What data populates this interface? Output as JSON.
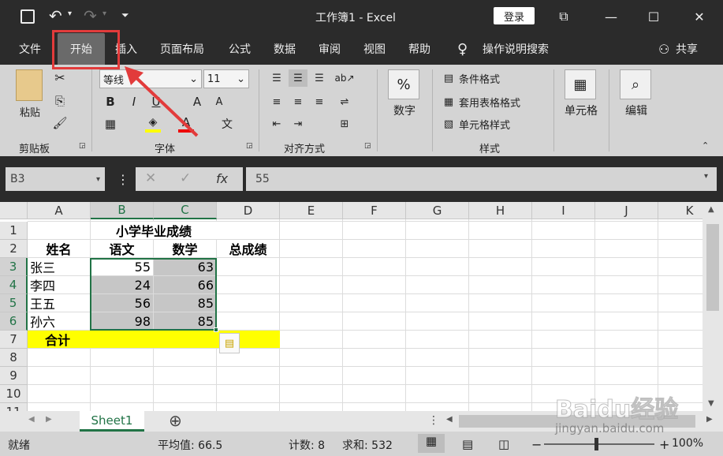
{
  "titlebar": {
    "title": "工作簿1 - Excel",
    "login": "登录",
    "undo": "↶",
    "redo": "↷"
  },
  "tabs": [
    "文件",
    "开始",
    "插入",
    "页面布局",
    "公式",
    "数据",
    "审阅",
    "视图",
    "帮助"
  ],
  "tell_me": "操作说明搜索",
  "share": "共享",
  "ribbon": {
    "clipboard": {
      "paste": "粘贴",
      "label": "剪贴板"
    },
    "font": {
      "name": "等线",
      "size": "11",
      "bold": "B",
      "italic": "I",
      "underline": "U",
      "grow": "A",
      "shrink": "A",
      "color": "A",
      "phonetic": "文",
      "label": "字体"
    },
    "alignment": {
      "label": "对齐方式"
    },
    "number": {
      "symbol": "%",
      "label": "数字"
    },
    "styles": {
      "conditional": "条件格式",
      "table": "套用表格格式",
      "cell": "单元格样式",
      "label": "样式"
    },
    "cells": {
      "label": "单元格"
    },
    "editing": {
      "label": "编辑"
    }
  },
  "formula_bar": {
    "name_box": "B3",
    "fx": "fx",
    "value": "55"
  },
  "columns": [
    "A",
    "B",
    "C",
    "D",
    "E",
    "F",
    "G",
    "H",
    "I",
    "J",
    "K"
  ],
  "rows": [
    "1",
    "2",
    "3",
    "4",
    "5",
    "6",
    "7",
    "8",
    "9",
    "10",
    "11"
  ],
  "sheet": {
    "title": "小学毕业成绩",
    "headers": {
      "name": "姓名",
      "chinese": "语文",
      "math": "数学",
      "total": "总成绩"
    },
    "records": [
      {
        "name": "张三",
        "chinese": "55",
        "math": "63"
      },
      {
        "name": "李四",
        "chinese": "24",
        "math": "66"
      },
      {
        "name": "王五",
        "chinese": "56",
        "math": "85"
      },
      {
        "name": "孙六",
        "chinese": "98",
        "math": "85"
      }
    ],
    "sum_label": "合计"
  },
  "sheet_tab": "Sheet1",
  "add_sheet": "⊕",
  "status": {
    "ready": "就绪",
    "average": "平均值: 66.5",
    "count": "计数: 8",
    "sum": "求和: 532",
    "zoom": "100%",
    "minus": "−",
    "plus": "+"
  },
  "watermark": {
    "brand": "Baidu经验",
    "url": "jingyan.baidu.com"
  },
  "colors": {
    "accent": "#217346",
    "highlight": "#ffff00",
    "annotation": "#e23b3b"
  }
}
